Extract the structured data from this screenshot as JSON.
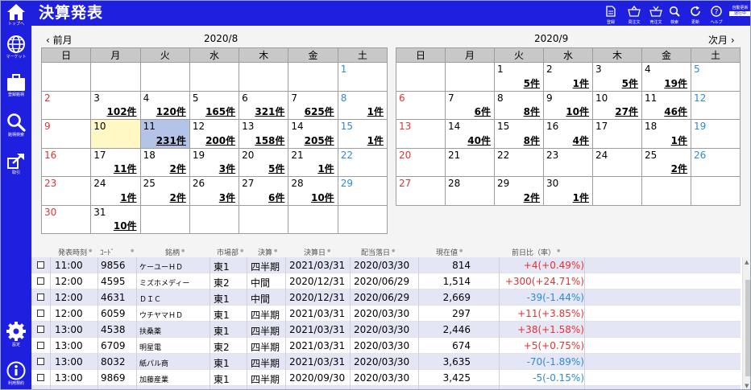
{
  "app": {
    "title": "決算発表"
  },
  "sidebar": [
    {
      "label": "トップへ",
      "icon": "home-icon"
    },
    {
      "label": "マーケット",
      "icon": "globe-icon"
    },
    {
      "label": "登録銘柄",
      "icon": "briefcase-icon"
    },
    {
      "label": "銘柄検索",
      "icon": "search-icon"
    },
    {
      "label": "取引",
      "icon": "trade-icon"
    },
    {
      "label": "設定",
      "icon": "gear-icon"
    },
    {
      "label": "利用規約",
      "icon": "info-icon"
    }
  ],
  "toolbar": [
    {
      "label": "登録",
      "icon": "register-icon"
    },
    {
      "label": "買注文",
      "icon": "buy-order-icon"
    },
    {
      "label": "売注文",
      "icon": "sell-order-icon"
    },
    {
      "label": "検索",
      "icon": "search-icon"
    },
    {
      "label": "更新",
      "icon": "refresh-icon"
    },
    {
      "label": "ヘルプ",
      "icon": "help-icon"
    }
  ],
  "auto_update": {
    "label": "自動更新",
    "status": "運行中"
  },
  "nav": {
    "prev": "前月",
    "next": "次月"
  },
  "weekdays": [
    "日",
    "月",
    "火",
    "水",
    "木",
    "金",
    "土"
  ],
  "calendars": [
    {
      "title": "2020/8",
      "weeks": [
        [
          [
            "",
            ""
          ],
          [
            "",
            ""
          ],
          [
            "",
            ""
          ],
          [
            "",
            ""
          ],
          [
            "",
            ""
          ],
          [
            "",
            ""
          ],
          [
            "1",
            ""
          ]
        ],
        [
          [
            "2",
            ""
          ],
          [
            "3",
            "102件"
          ],
          [
            "4",
            "120件"
          ],
          [
            "5",
            "165件"
          ],
          [
            "6",
            "321件"
          ],
          [
            "7",
            "625件"
          ],
          [
            "8",
            "1件"
          ]
        ],
        [
          [
            "9",
            ""
          ],
          [
            "10",
            ""
          ],
          [
            "11",
            "231件"
          ],
          [
            "12",
            "200件"
          ],
          [
            "13",
            "158件"
          ],
          [
            "14",
            "205件"
          ],
          [
            "15",
            "1件"
          ]
        ],
        [
          [
            "16",
            ""
          ],
          [
            "17",
            "11件"
          ],
          [
            "18",
            "2件"
          ],
          [
            "19",
            "3件"
          ],
          [
            "20",
            "5件"
          ],
          [
            "21",
            "1件"
          ],
          [
            "22",
            ""
          ]
        ],
        [
          [
            "23",
            ""
          ],
          [
            "24",
            "1件"
          ],
          [
            "25",
            "2件"
          ],
          [
            "26",
            "3件"
          ],
          [
            "27",
            "6件"
          ],
          [
            "28",
            "10件"
          ],
          [
            "29",
            ""
          ]
        ],
        [
          [
            "30",
            ""
          ],
          [
            "31",
            "10件"
          ],
          [
            "",
            ""
          ],
          [
            "",
            ""
          ],
          [
            "",
            ""
          ],
          [
            "",
            ""
          ],
          [
            "",
            ""
          ]
        ]
      ]
    },
    {
      "title": "2020/9",
      "weeks": [
        [
          [
            "",
            ""
          ],
          [
            "",
            ""
          ],
          [
            "1",
            "5件"
          ],
          [
            "2",
            "1件"
          ],
          [
            "3",
            "5件"
          ],
          [
            "4",
            "19件"
          ],
          [
            "5",
            ""
          ]
        ],
        [
          [
            "6",
            ""
          ],
          [
            "7",
            "6件"
          ],
          [
            "8",
            "8件"
          ],
          [
            "9",
            "10件"
          ],
          [
            "10",
            "27件"
          ],
          [
            "11",
            "46件"
          ],
          [
            "12",
            ""
          ]
        ],
        [
          [
            "13",
            ""
          ],
          [
            "14",
            "40件"
          ],
          [
            "15",
            "8件"
          ],
          [
            "16",
            "4件"
          ],
          [
            "17",
            ""
          ],
          [
            "18",
            "1件"
          ],
          [
            "19",
            ""
          ]
        ],
        [
          [
            "20",
            ""
          ],
          [
            "21",
            ""
          ],
          [
            "22",
            ""
          ],
          [
            "23",
            ""
          ],
          [
            "24",
            ""
          ],
          [
            "25",
            "2件"
          ],
          [
            "26",
            ""
          ]
        ],
        [
          [
            "27",
            ""
          ],
          [
            "28",
            ""
          ],
          [
            "29",
            "2件"
          ],
          [
            "30",
            "1件"
          ],
          [
            "",
            ""
          ],
          [
            "",
            ""
          ],
          [
            "",
            ""
          ]
        ]
      ]
    }
  ],
  "list": {
    "headers": [
      "発表時刻",
      "ｺｰﾄﾞ",
      "銘柄",
      "市場部",
      "決算",
      "決算日",
      "配当落日",
      "現在値",
      "前日比（率）"
    ],
    "rows": [
      {
        "time": "11:00",
        "code": "9856",
        "name": "ケーユーＨＤ",
        "market": "東1",
        "kind": "四半期",
        "date": "2021/03/31",
        "exdiv": "2020/03/30",
        "price": "814",
        "change": "+4(+0.49%)",
        "dir": "pos"
      },
      {
        "time": "12:00",
        "code": "4595",
        "name": "ミズホメディー",
        "market": "東2",
        "kind": "中間",
        "date": "2020/12/31",
        "exdiv": "2020/06/29",
        "price": "1,514",
        "change": "+300(+24.71%)",
        "dir": "pos"
      },
      {
        "time": "12:00",
        "code": "4631",
        "name": "ＤＩＣ",
        "market": "東1",
        "kind": "中間",
        "date": "2020/12/31",
        "exdiv": "2020/06/29",
        "price": "2,669",
        "change": "-39(-1.44%)",
        "dir": "neg"
      },
      {
        "time": "12:00",
        "code": "6059",
        "name": "ウチヤマＨＤ",
        "market": "東1",
        "kind": "四半期",
        "date": "2021/03/31",
        "exdiv": "2020/03/30",
        "price": "297",
        "change": "+11(+3.85%)",
        "dir": "pos"
      },
      {
        "time": "13:00",
        "code": "4538",
        "name": "扶桑薬",
        "market": "東1",
        "kind": "四半期",
        "date": "2021/03/31",
        "exdiv": "2020/03/30",
        "price": "2,446",
        "change": "+38(+1.58%)",
        "dir": "pos"
      },
      {
        "time": "13:00",
        "code": "6709",
        "name": "明星電",
        "market": "東2",
        "kind": "四半期",
        "date": "2021/03/31",
        "exdiv": "2020/03/30",
        "price": "674",
        "change": "+5(+0.75%)",
        "dir": "pos"
      },
      {
        "time": "13:00",
        "code": "8032",
        "name": "紙パル商",
        "market": "東1",
        "kind": "四半期",
        "date": "2021/03/31",
        "exdiv": "2020/03/30",
        "price": "3,635",
        "change": "-70(-1.89%)",
        "dir": "neg"
      },
      {
        "time": "13:00",
        "code": "9869",
        "name": "加藤産業",
        "market": "東1",
        "kind": "四半期",
        "date": "2020/09/30",
        "exdiv": "2020/03/30",
        "price": "3,425",
        "change": "-5(-0.15%)",
        "dir": "neg"
      },
      {
        "time": "",
        "code": "",
        "name": "",
        "market": "",
        "kind": "",
        "date": "",
        "exdiv": "",
        "price": "",
        "change": "",
        "dir": "pos"
      }
    ]
  },
  "colors": {
    "brand": "#1f1fe0",
    "positive": "#e23232",
    "negative": "#2e8ad8",
    "today": "#fff8c4",
    "selected": "#b4c4e8"
  }
}
